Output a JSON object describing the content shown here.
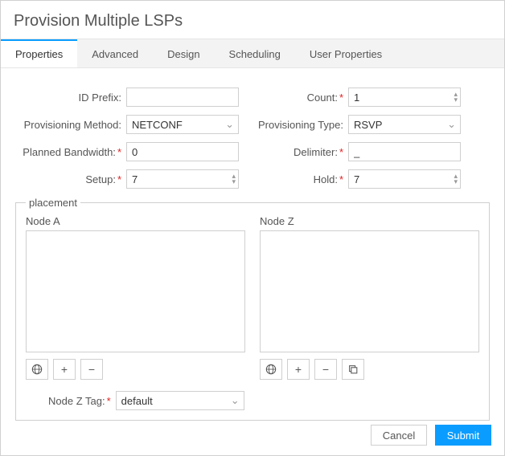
{
  "dialog": {
    "title": "Provision Multiple LSPs"
  },
  "tabs": {
    "properties": "Properties",
    "advanced": "Advanced",
    "design": "Design",
    "scheduling": "Scheduling",
    "user_properties": "User Properties"
  },
  "fields": {
    "id_prefix": {
      "label": "ID Prefix:",
      "value": ""
    },
    "count": {
      "label": "Count:",
      "value": "1"
    },
    "provisioning_method": {
      "label": "Provisioning Method:",
      "value": "NETCONF"
    },
    "provisioning_type": {
      "label": "Provisioning Type:",
      "value": "RSVP"
    },
    "planned_bandwidth": {
      "label": "Planned Bandwidth:",
      "value": "0"
    },
    "delimiter": {
      "label": "Delimiter:",
      "value": "_"
    },
    "setup": {
      "label": "Setup:",
      "value": "7"
    },
    "hold": {
      "label": "Hold:",
      "value": "7"
    },
    "node_z_tag": {
      "label": "Node Z Tag:",
      "value": "default"
    }
  },
  "placement": {
    "legend": "placement",
    "node_a_label": "Node A",
    "node_z_label": "Node Z"
  },
  "buttons": {
    "cancel": "Cancel",
    "submit": "Submit"
  },
  "required_mark": "*"
}
